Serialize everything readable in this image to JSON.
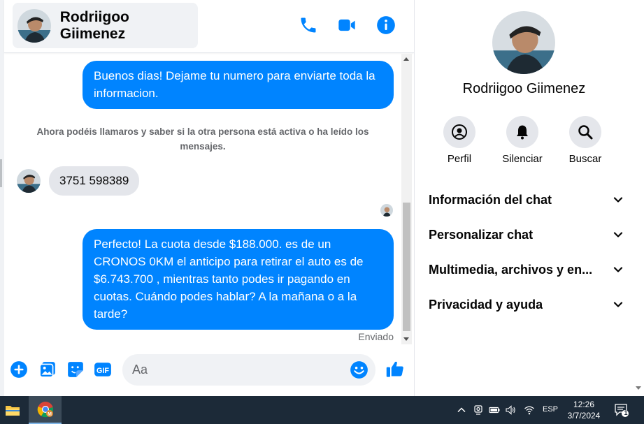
{
  "chat": {
    "contact_name": "Rodriigoo Giimenez",
    "messages": {
      "out_1": "Buenos dias! Dejame tu numero para enviarte toda la informacion.",
      "system_note": "Ahora podéis llamaros y saber si la otra persona está activa o ha leído los mensajes.",
      "in_1": "3751 598389",
      "out_2": "Perfecto! La cuota desde $188.000. es de un CRONOS 0KM el anticipo para retirar el auto es de $6.743.700 , mientras tanto podes ir pagando en cuotas. Cuándo podes hablar? A la mañana o a la tarde?",
      "status": "Enviado"
    },
    "composer": {
      "placeholder": "Aa"
    }
  },
  "right_panel": {
    "name": "Rodriigoo Giimenez",
    "actions": [
      {
        "label": "Perfil",
        "icon": "profile-icon"
      },
      {
        "label": "Silenciar",
        "icon": "bell-icon"
      },
      {
        "label": "Buscar",
        "icon": "search-icon"
      }
    ],
    "sections": [
      {
        "title": "Información del chat"
      },
      {
        "title": "Personalizar chat"
      },
      {
        "title": "Multimedia, archivos y en..."
      },
      {
        "title": "Privacidad y ayuda"
      }
    ]
  },
  "taskbar": {
    "language": "ESP",
    "time": "12:26",
    "date": "3/7/2024",
    "notification_count": "1"
  },
  "colors": {
    "accent": "#0084ff",
    "incoming_bubble": "#e4e6eb",
    "panel_bg": "#f0f2f5",
    "taskbar": "#1c2a38"
  }
}
